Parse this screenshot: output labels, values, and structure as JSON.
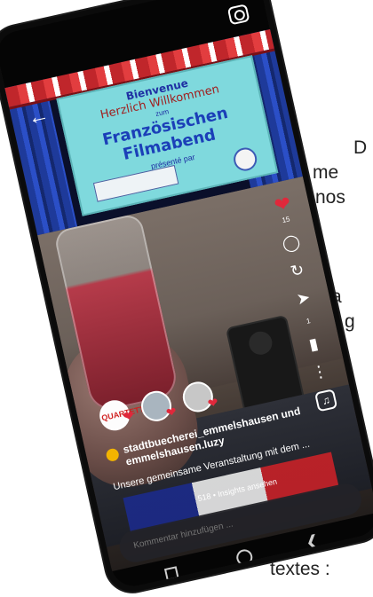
{
  "background_text": {
    "line1": "D",
    "line2": "me",
    "line3": "nos",
    "line4": "a",
    "line5": "g",
    "line6": "",
    "line7": "textes :"
  },
  "slide": {
    "bienvenue": "Bienvenue",
    "herzlich": "Herzlich Willkommen",
    "zum": "zum",
    "title": "Französischen Filmabend",
    "presente": "présenté par"
  },
  "actions": {
    "like_count": "15",
    "send_count": "1"
  },
  "avatars": [
    "QUARTETT"
  ],
  "post": {
    "author": "stadtbuecherei_emmelshausen und emmelshausen.luzy",
    "caption": "Unsere gemeinsame Veranstaltung mit dem ...",
    "insights": "518 • Insights ansehen"
  },
  "comment": {
    "placeholder": "Kommentar hinzufügen ..."
  },
  "icons": {
    "back": "back-arrow-icon",
    "camera": "camera-icon",
    "heart": "heart-icon",
    "comment": "comment-icon",
    "repost": "repost-icon",
    "send": "send-icon",
    "bookmark": "bookmark-icon",
    "more": "more-icon",
    "music": "music-icon"
  },
  "colors": {
    "heart": "#e0283b",
    "slide_bg": "#7fd9dd",
    "title_blue": "#1b3fb8"
  }
}
